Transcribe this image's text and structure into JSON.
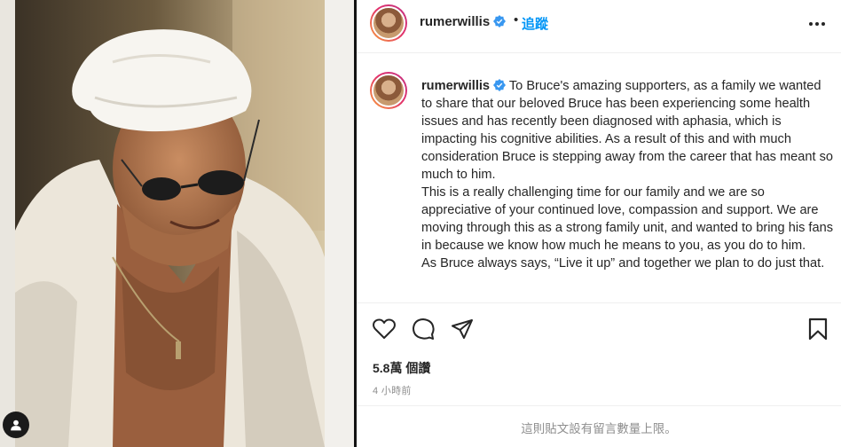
{
  "post": {
    "username": "rumerwillis",
    "separator": "•",
    "follow_label": "追蹤",
    "caption_username": "rumerwillis",
    "caption_paragraphs": [
      "To Bruce's amazing supporters, as a family we wanted to share that our beloved Bruce has been experiencing some health issues and has recently been diagnosed with aphasia, which is impacting his cognitive abilities. As a result of this and with much consideration Bruce is stepping away from the career that has meant so much to him.",
      "This is a really challenging time for our family and we are so appreciative of your continued love, compassion and support. We are moving through this as a strong family unit, and wanted to bring his fans in because we know how much he means to you, as you do to him.",
      "As Bruce always says, “Live it up” and together we plan to do just that."
    ],
    "views": "5.8萬 個讚",
    "time_ago": "4 小時前",
    "comments_disabled_text": "這則貼文設有留言數量上限。"
  },
  "icons": {
    "verified": "verified-badge-icon",
    "more": "more-options-icon",
    "like": "heart-icon",
    "comment": "comment-bubble-icon",
    "share": "paper-plane-icon",
    "save": "bookmark-icon",
    "user_tag": "person-icon"
  },
  "colors": {
    "accent": "#0095f6",
    "verified": "#3897f0",
    "text": "#262626",
    "muted": "#8e8e8e"
  }
}
